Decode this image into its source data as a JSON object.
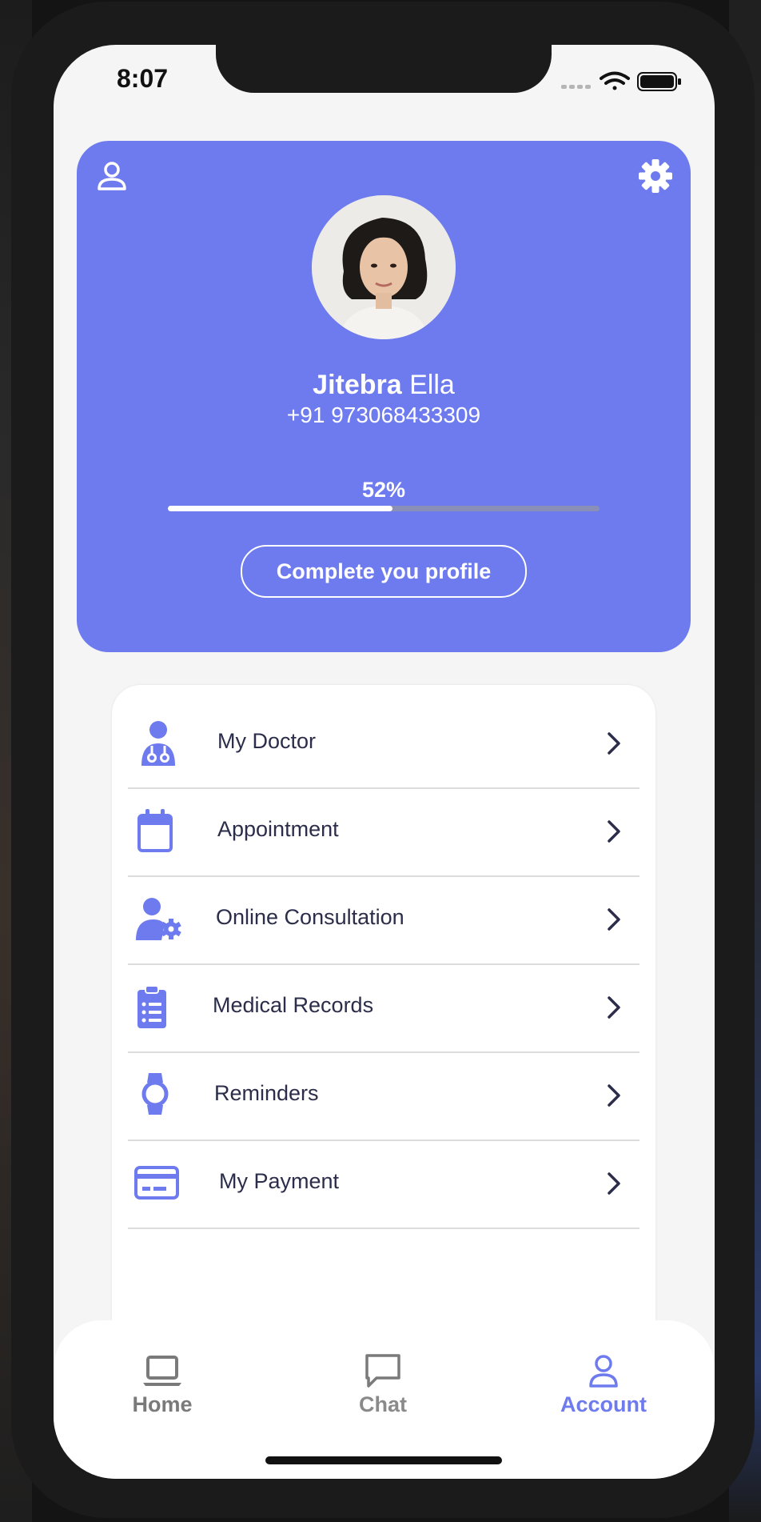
{
  "status_bar": {
    "time": "8:07"
  },
  "profile": {
    "first_name": "Jitebra",
    "last_name": "Ella",
    "phone": "+91 973068433309",
    "completion_text": "52%",
    "completion_fraction": 0.52,
    "complete_button_label": "Complete you profile"
  },
  "menu": [
    {
      "label": "My Doctor",
      "icon": "doctor-icon"
    },
    {
      "label": "Appointment",
      "icon": "calendar-icon"
    },
    {
      "label": "Online Consultation",
      "icon": "user-gear-icon"
    },
    {
      "label": "Medical Records",
      "icon": "clipboard-list-icon"
    },
    {
      "label": "Reminders",
      "icon": "watch-icon"
    },
    {
      "label": "My Payment",
      "icon": "credit-card-icon"
    }
  ],
  "tabs": [
    {
      "label": "Home",
      "icon": "laptop-icon",
      "active": false
    },
    {
      "label": "Chat",
      "icon": "chat-icon",
      "active": false
    },
    {
      "label": "Account",
      "icon": "user-icon",
      "active": true
    }
  ],
  "colors": {
    "accent": "#6e7bef",
    "text_dark": "#2b2d4a",
    "tab_inactive": "#7a7a7a",
    "divider": "#dcdcdc"
  }
}
